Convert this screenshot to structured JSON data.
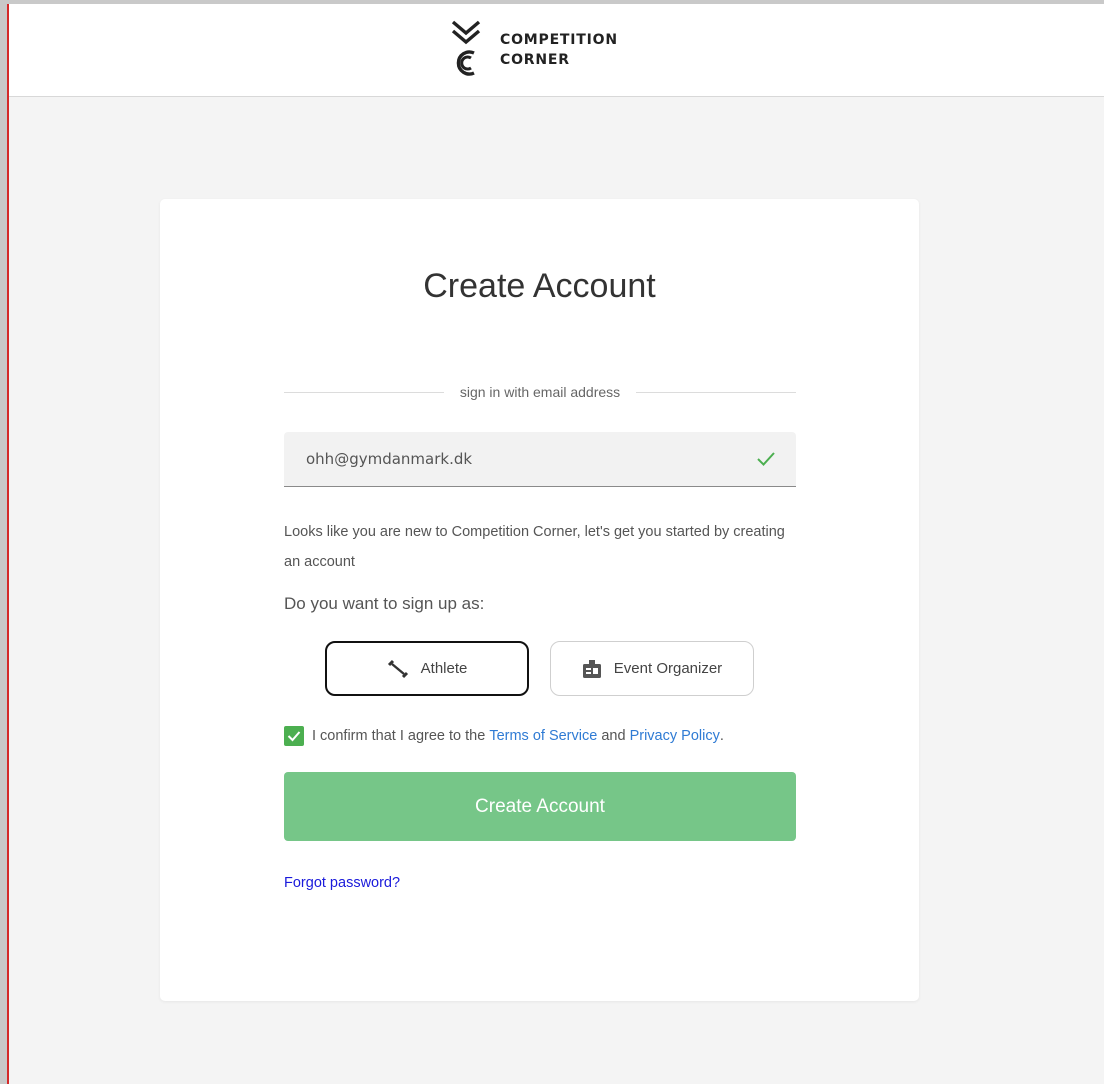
{
  "header": {
    "logo_line1": "COMPETITION",
    "logo_line2": "CORNER",
    "logo_icon": "chevron-cc-logo-icon"
  },
  "card": {
    "title": "Create Account",
    "divider_label": "sign in with email address",
    "email": {
      "value": "ohh@gymdanmark.dk",
      "valid_icon": "checkmark-icon"
    },
    "notice": "Looks like you are new to Competition Corner, let's get you started by creating an account",
    "role_prompt": "Do you want to sign up as:",
    "roles": [
      {
        "label": "Athlete",
        "icon": "dumbbell-icon",
        "selected": true
      },
      {
        "label": "Event Organizer",
        "icon": "id-badge-icon",
        "selected": false
      }
    ],
    "consent": {
      "checked": true,
      "prefix": "I confirm that I agree to the",
      "terms_link": "Terms of Service",
      "conjunction": "and",
      "privacy_link": "Privacy Policy",
      "suffix": "."
    },
    "submit_label": "Create Account",
    "forgot_label": "Forgot password?"
  },
  "colors": {
    "accent_green": "#76c688",
    "checkbox_green": "#4caf50",
    "link_blue": "#2f7bd4",
    "forgot_link": "#1a1adb",
    "frame_border": "#d42a2a"
  }
}
